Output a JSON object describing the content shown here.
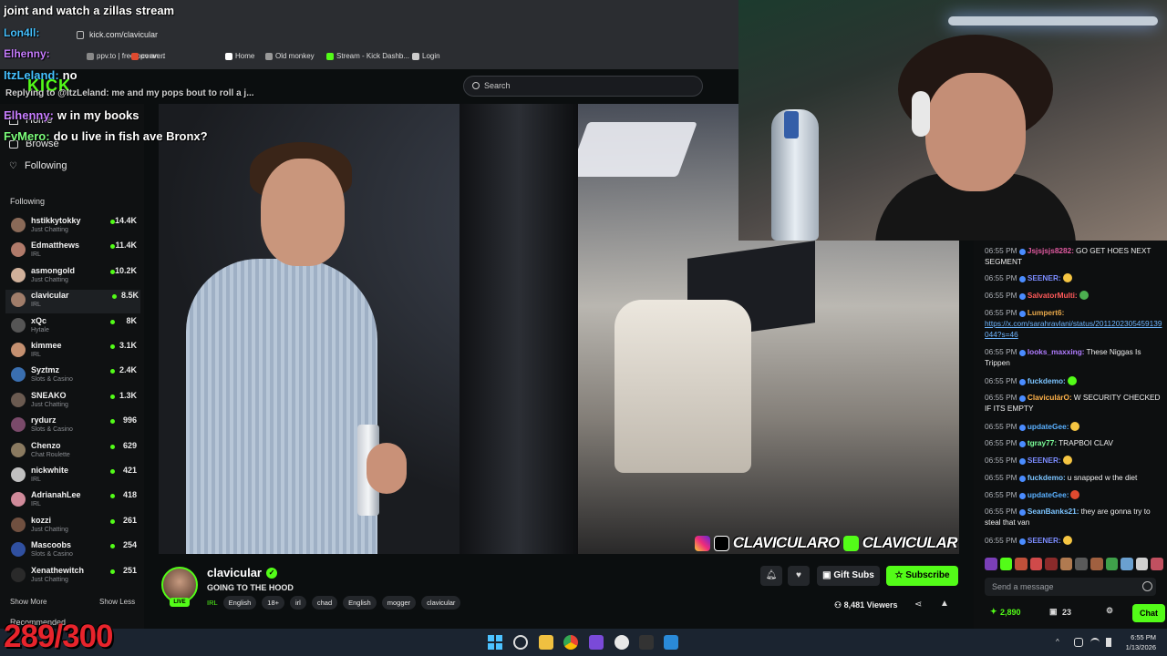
{
  "browser": {
    "url": "kick.com/clavicular",
    "bookmarks": [
      {
        "label": "ppv.to | free ppv an...",
        "icon": "ppv-icon",
        "color": "#888"
      },
      {
        "label": "convert",
        "icon": "convert-icon",
        "color": "#e04a2f"
      },
      {
        "label": "Home",
        "icon": "x-icon",
        "color": "#ffffff"
      },
      {
        "label": "Old monkey",
        "icon": "globe-icon",
        "color": "#999"
      },
      {
        "label": "Stream - Kick Dashb...",
        "icon": "kick-icon",
        "color": "#53fc18"
      },
      {
        "label": "Login",
        "icon": "kick-k-icon",
        "color": "#cccccc"
      }
    ]
  },
  "search": {
    "placeholder": "Search"
  },
  "sidebar": {
    "nav": [
      {
        "label": "Home"
      },
      {
        "label": "Browse"
      },
      {
        "label": "Following"
      }
    ],
    "following_title": "Following",
    "channels": [
      {
        "name": "hstikkytokky",
        "category": "Just Chatting",
        "viewers": "14.4K",
        "color": "#8a6a58"
      },
      {
        "name": "Edmatthews",
        "category": "IRL",
        "viewers": "11.4K",
        "color": "#b07a6a"
      },
      {
        "name": "asmongold",
        "category": "Just Chatting",
        "viewers": "10.2K",
        "color": "#d0b09a"
      },
      {
        "name": "clavicular",
        "category": "IRL",
        "viewers": "8.5K",
        "color": "#a07d6a"
      },
      {
        "name": "xQc",
        "category": "Hytale",
        "viewers": "8K",
        "color": "#555555"
      },
      {
        "name": "kimmee",
        "category": "IRL",
        "viewers": "3.1K",
        "color": "#c49070"
      },
      {
        "name": "Syztmz",
        "category": "Slots & Casino",
        "viewers": "2.4K",
        "color": "#3a6fb0"
      },
      {
        "name": "SNEAKO",
        "category": "Just Chatting",
        "viewers": "1.3K",
        "color": "#6a5a50"
      },
      {
        "name": "rydurz",
        "category": "Slots & Casino",
        "viewers": "996",
        "color": "#7a4a6a"
      },
      {
        "name": "Chenzo",
        "category": "Chat Roulette",
        "viewers": "629",
        "color": "#8a7a60"
      },
      {
        "name": "nickwhite",
        "category": "IRL",
        "viewers": "421",
        "color": "#c0c0c0"
      },
      {
        "name": "AdrianahLee",
        "category": "IRL",
        "viewers": "418",
        "color": "#d08a9a"
      },
      {
        "name": "kozzi",
        "category": "Just Chatting",
        "viewers": "261",
        "color": "#705040"
      },
      {
        "name": "Mascoobs",
        "category": "Slots & Casino",
        "viewers": "254",
        "color": "#3050a0"
      },
      {
        "name": "Xenathewitch",
        "category": "Just Chatting",
        "viewers": "251",
        "color": "#2a2a2a"
      }
    ],
    "show_more": "Show More",
    "show_less": "Show Less",
    "recommended": "Recommended"
  },
  "overlay_chat": {
    "lines": [
      {
        "user": "",
        "text": "joint and watch a zillas stream",
        "color": "#ffffff"
      },
      {
        "user": "Lon4ll:",
        "text": "",
        "color": "#45c1ff"
      },
      {
        "user": "Elhenny:",
        "text": "",
        "color": "#c77dff"
      },
      {
        "user": "ItzLeland:",
        "text": "no",
        "color": "#45c1ff"
      },
      {
        "user": "Elhenny:",
        "text": "w in my books",
        "color": "#c77dff"
      },
      {
        "user": "FvMero:",
        "text": "do u live in fish ave Bronx?",
        "color": "#7cff7c"
      }
    ],
    "reply": "Replying to @ItzLeland: me and my pops bout to roll a j...",
    "brand": "KICK"
  },
  "video": {
    "watermark_ig": "CLAVICULARO",
    "watermark_kick": "CLAVICULAR"
  },
  "chat": {
    "messages": [
      {
        "time": "06:55 PM",
        "user": "Jsjsjsjs8282:",
        "user_color": "#e05aa0",
        "text": "GO GET HOES NEXT SEGMENT"
      },
      {
        "time": "06:55 PM",
        "user": "SEENER:",
        "user_color": "#7c8cff",
        "text": "",
        "emote": "#f5c542"
      },
      {
        "time": "06:55 PM",
        "user": "SalvatorMulti:",
        "user_color": "#ff5a5a",
        "text": "",
        "emote": "#4caf50"
      },
      {
        "time": "06:55 PM",
        "user": "Lumpert6:",
        "user_color": "#e8a84a",
        "text": "",
        "link": "https://x.com/sarahravlani/status/2011202305459139044?s=46"
      },
      {
        "time": "06:55 PM",
        "user": "looks_maxxing:",
        "user_color": "#b07cff",
        "text": "These Niggas Is Trippen"
      },
      {
        "time": "06:55 PM",
        "user": "fuckdemo:",
        "user_color": "#7cc4ff",
        "text": "",
        "emote": "#53fc18"
      },
      {
        "time": "06:55 PM",
        "user": "ClaviculárO:",
        "user_color": "#ffb24a",
        "text": "W SECURITY CHECKED IF ITS EMPTY"
      },
      {
        "time": "06:55 PM",
        "user": "updateGee:",
        "user_color": "#5ab0ff",
        "text": "",
        "emote": "#f5c542"
      },
      {
        "time": "06:55 PM",
        "user": "tgray77:",
        "user_color": "#7cff9a",
        "text": "TRAPBOI CLAV"
      },
      {
        "time": "06:55 PM",
        "user": "SEENER:",
        "user_color": "#7c8cff",
        "text": "",
        "emote": "#f5c542"
      },
      {
        "time": "06:55 PM",
        "user": "fuckdemo:",
        "user_color": "#7cc4ff",
        "text": "u snapped w the diet"
      },
      {
        "time": "06:55 PM",
        "user": "updateGee:",
        "user_color": "#5ab0ff",
        "text": "",
        "emote": "#e04a2f"
      },
      {
        "time": "06:55 PM",
        "user": "SeanBanks21:",
        "user_color": "#7cc4ff",
        "text": "they are gonna try to steal that van"
      },
      {
        "time": "06:55 PM",
        "user": "SEENER:",
        "user_color": "#7c8cff",
        "text": "",
        "emote": "#f5c542"
      }
    ],
    "input_placeholder": "Send a message",
    "points": "2,890",
    "gifts": "23",
    "chat_button": "Chat"
  },
  "stream": {
    "channel": "clavicular",
    "live": "LIVE",
    "title": "GOING TO THE HOOD",
    "category": "IRL",
    "tags": [
      "English",
      "18+",
      "irl",
      "chad",
      "English",
      "mogger",
      "clavicular"
    ],
    "gift_label": "Gift Subs",
    "subscribe_label": "Subscribe",
    "viewers": "8,481 Viewers"
  },
  "taskbar": {
    "time": "6:55 PM",
    "date": "1/13/2026"
  },
  "counter": "289/300",
  "colors": {
    "kick_green": "#53fc18",
    "bg": "#0b0e0f",
    "counter_red": "#e8242c"
  }
}
